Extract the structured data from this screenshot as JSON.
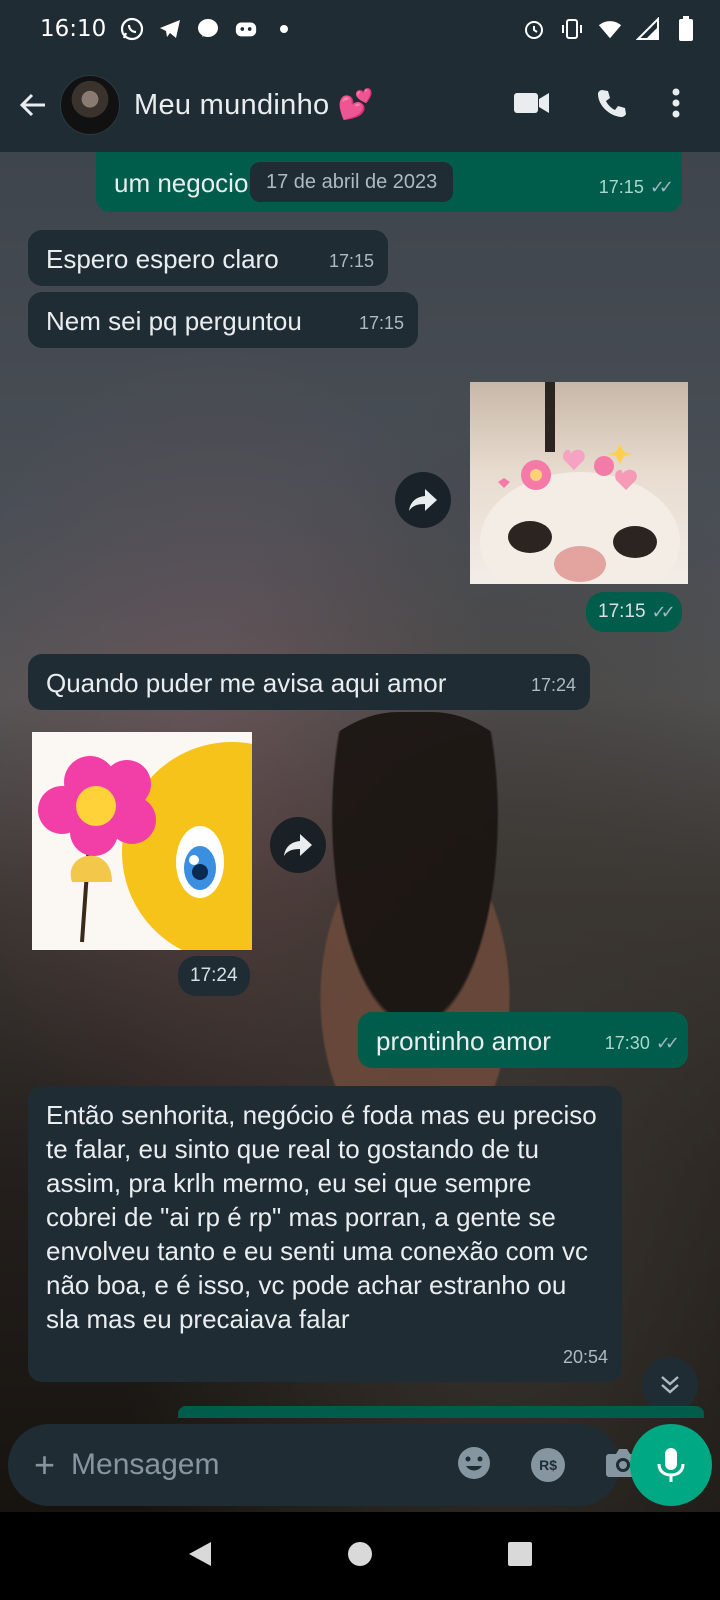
{
  "status_bar": {
    "time": "16:10",
    "left_icons": [
      "whatsapp-icon",
      "telegram-icon",
      "messenger-icon",
      "discord-icon",
      "dot-icon"
    ],
    "right_icons": [
      "alarm-icon",
      "vibrate-icon",
      "wifi-icon",
      "signal-icon",
      "battery-icon"
    ]
  },
  "header": {
    "contact_name": "Meu mundinho 💕",
    "actions": [
      "video-call-icon",
      "voice-call-icon",
      "more-vert-icon"
    ]
  },
  "date_chip": "17 de abril de 2023",
  "messages": [
    {
      "side": "out",
      "text": "um negocio",
      "time": "17:15",
      "ticks": "✓✓"
    },
    {
      "side": "in",
      "text": "Espero espero claro",
      "time": "17:15"
    },
    {
      "side": "in",
      "text": "Nem sei pq perguntou",
      "time": "17:15"
    },
    {
      "side": "out",
      "type": "sticker",
      "sticker": "cat-with-hearts",
      "time": "17:15",
      "ticks": "✓✓"
    },
    {
      "side": "in",
      "text": "Quando puder me avisa aqui amor",
      "time": "17:24"
    },
    {
      "side": "in",
      "type": "sticker",
      "sticker": "smiley-with-flower",
      "time": "17:24"
    },
    {
      "side": "out",
      "text": "prontinho amor",
      "time": "17:30",
      "ticks": "✓✓"
    },
    {
      "side": "in",
      "text": "Então senhorita, negócio é foda mas eu preciso te falar, eu sinto que real to gostando de tu assim, pra krlh mermo, eu sei que sempre cobrei de \"ai rp é rp\" mas porran, a gente se envolveu tanto e eu senti uma conexão com vc não boa, e é isso, vc pode achar estranho ou sla mas eu precaiava falar",
      "time": "20:54"
    }
  ],
  "composer": {
    "placeholder": "Mensagem",
    "icons": [
      "emoji-icon",
      "pix-payment-icon",
      "camera-icon",
      "mic-icon"
    ],
    "pix_label": "R$"
  },
  "colors": {
    "header_bg": "#1f2c34",
    "incoming_bubble": "#1f2c34",
    "outgoing_bubble": "#005c4b",
    "accent": "#00a884"
  }
}
